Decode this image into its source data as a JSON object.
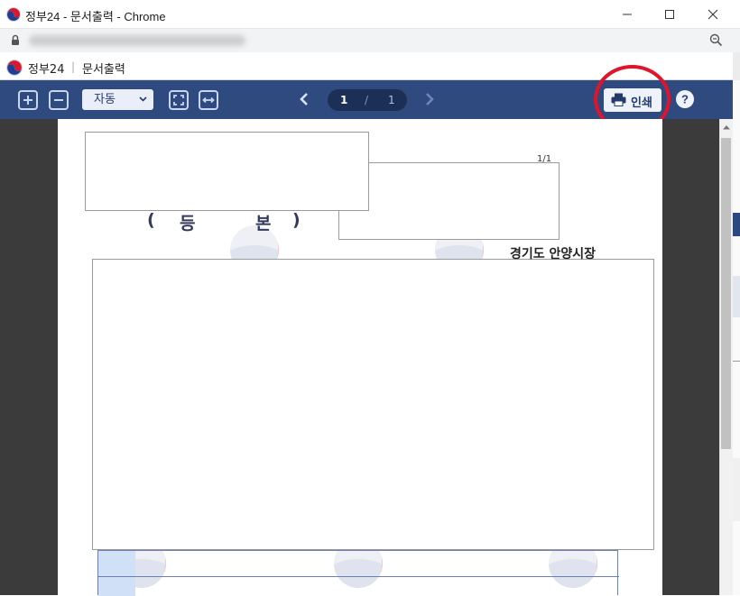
{
  "window": {
    "title": "정부24 - 문서출력 - Chrome",
    "controls": [
      "minimize",
      "maximize",
      "close"
    ]
  },
  "address_bar": {
    "icons": [
      "lock-icon",
      "zoom-icon"
    ]
  },
  "site_bar": {
    "brand": "정부24",
    "separator": "|",
    "page_title": "문서출력"
  },
  "toolbar": {
    "zoom_select_value": "자동",
    "page_current": "1",
    "page_separator": "/",
    "page_total": "1",
    "print_label": "인쇄",
    "help_label": "?",
    "icons": [
      "zoom-in-icon",
      "zoom-out-icon",
      "fit-page-icon",
      "fit-width-icon",
      "prev-page-icon",
      "next-page-icon",
      "print-icon",
      "help-icon"
    ]
  },
  "document": {
    "page_number": "1/1",
    "heading_open": "(",
    "heading_char1": "등",
    "heading_char2": "본",
    "heading_close": ")",
    "issuer": "경기도 안양시장"
  },
  "colors": {
    "toolbar_bg": "#2f4a7e",
    "annotation": "#e0142a",
    "viewer_bg": "#3b3b3b"
  }
}
